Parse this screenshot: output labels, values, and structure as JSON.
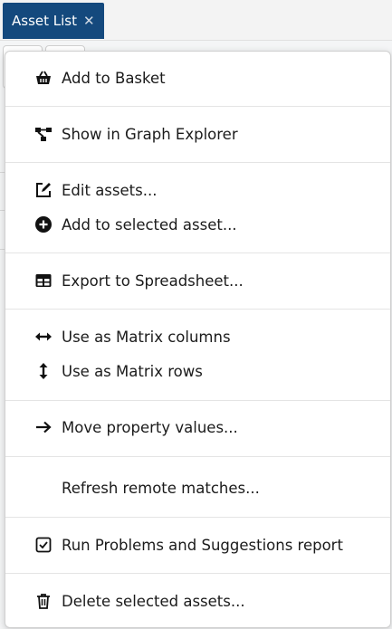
{
  "tab": {
    "title": "Asset List",
    "close_glyph": "✕"
  },
  "menu": {
    "items": [
      {
        "label": "Add to Basket",
        "icon": "basket-icon"
      },
      {
        "label": "Show in Graph Explorer",
        "icon": "graph-icon"
      },
      {
        "label": "Edit assets...",
        "icon": "edit-icon"
      },
      {
        "label": "Add to selected asset...",
        "icon": "plus-circle-icon"
      },
      {
        "label": "Export to Spreadsheet...",
        "icon": "table-icon"
      },
      {
        "label": "Use as Matrix columns",
        "icon": "arrows-horizontal-icon"
      },
      {
        "label": "Use as Matrix rows",
        "icon": "arrows-vertical-icon"
      },
      {
        "label": "Move property values...",
        "icon": "arrow-right-icon"
      },
      {
        "label": "Refresh remote matches...",
        "icon": ""
      },
      {
        "label": "Run Problems and Suggestions report",
        "icon": "checkbox-icon"
      },
      {
        "label": "Delete selected assets...",
        "icon": "trash-icon"
      }
    ]
  }
}
